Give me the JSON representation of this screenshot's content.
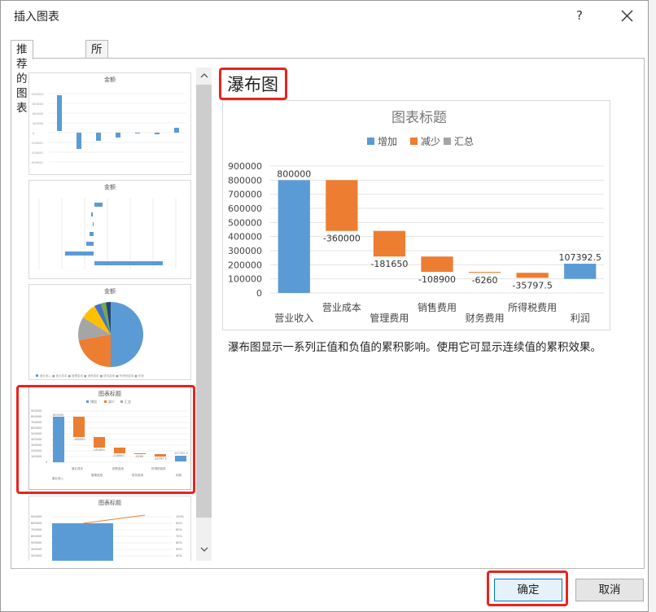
{
  "dialog": {
    "title": "插入图表",
    "help": "?",
    "tabs": [
      "推荐的图表",
      "所有图表"
    ],
    "chart_type_title": "瀑布图",
    "description": "瀑布图显示一系列正值和负值的累积影响。使用它可显示连续值的累积效果。",
    "ok_label": "确定",
    "cancel_label": "取消"
  },
  "thumbnails": [
    {
      "title": "金额"
    },
    {
      "title": "金额"
    },
    {
      "title": "金额"
    },
    {
      "title": "图表标题",
      "selected": true
    },
    {
      "title": "图表标题"
    }
  ],
  "chart_data": {
    "type": "bar",
    "title": "图表标题",
    "legend": [
      "增加",
      "减少",
      "汇总"
    ],
    "legend_placement": "top",
    "colors": {
      "increase": "#5b9bd5",
      "decrease": "#ed7d31",
      "total": "#a5a5a5"
    },
    "categories": [
      "营业收入",
      "营业成本",
      "管理费用",
      "销售费用",
      "财务费用",
      "所得税费用",
      "利润"
    ],
    "values": [
      800000,
      -360000,
      -181650,
      -108900,
      -6260,
      -35797.5,
      107392.5
    ],
    "value_labels": [
      "800000",
      "-360000",
      "-181650",
      "-108900",
      "-6260",
      "-35797.5",
      "107392.5"
    ],
    "y_ticks": [
      "900000",
      "800000",
      "700000",
      "600000",
      "500000",
      "400000",
      "300000",
      "200000",
      "100000",
      "0"
    ],
    "ylim": [
      0,
      900000
    ],
    "grid": true
  }
}
